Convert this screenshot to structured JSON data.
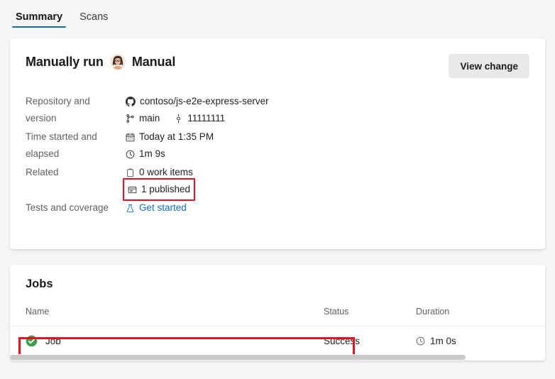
{
  "tabs": [
    {
      "label": "Summary",
      "active": true
    },
    {
      "label": "Scans",
      "active": false
    }
  ],
  "summary": {
    "run_title": "Manually run",
    "trigger_label": "Manual",
    "avatar_name": "user-avatar",
    "view_change_label": "View change",
    "rows": [
      {
        "label": "Repository and version",
        "lines": [
          {
            "icon": "github-icon",
            "text": "contoso/js-e2e-express-server"
          },
          {
            "icon": "branch-icon",
            "text": "main",
            "icon2": "commit-icon",
            "text2": "11111111"
          }
        ]
      },
      {
        "label": "Time started and elapsed",
        "lines": [
          {
            "icon": "calendar-icon",
            "text": "Today at 1:35 PM"
          },
          {
            "icon": "clock-icon",
            "text": "1m 9s"
          }
        ]
      },
      {
        "label": "Related",
        "lines": [
          {
            "icon": "work-items-icon",
            "text": "0 work items"
          },
          {
            "icon": "published-icon",
            "text": "1 published",
            "highlighted": true
          }
        ]
      },
      {
        "label": "Tests and coverage",
        "lines": [
          {
            "icon": "flask-icon",
            "text": "Get started",
            "link": true
          }
        ]
      }
    ]
  },
  "jobs": {
    "title": "Jobs",
    "columns": [
      "Name",
      "Status",
      "Duration"
    ],
    "rows": [
      {
        "status_icon": "success-check-icon",
        "name": "Job",
        "status": "Success",
        "duration_icon": "clock-icon",
        "duration": "1m 0s",
        "highlighted": true
      }
    ]
  },
  "colors": {
    "accent": "#0f6cbd",
    "highlight": "#e81123",
    "success": "#3e9c4e",
    "page_bg": "#f5f5f5",
    "card_bg": "#ffffff"
  }
}
